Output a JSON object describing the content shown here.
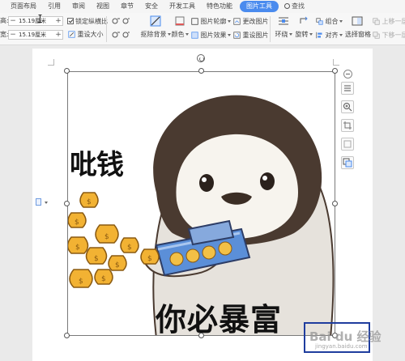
{
  "menu": {
    "tabs": [
      "页面布局",
      "引用",
      "审阅",
      "视图",
      "章节",
      "安全",
      "开发工具",
      "特色功能",
      "图片工具"
    ],
    "active_tab": "图片工具",
    "search_label": "查找"
  },
  "ribbon": {
    "height_label": "高:",
    "width_label": "宽:",
    "height_value": "15.19厘米",
    "width_value": "15.19厘米",
    "lock_ratio_label": "锁定纵横比",
    "lock_ratio_checked": true,
    "reset_size_label": "重设大小",
    "remove_bg_label": "抠除背景",
    "color_label": "颜色",
    "picture_outline_label": "图片轮廓",
    "picture_effect_label": "图片效果",
    "change_picture_label": "更改图片",
    "reset_picture_label": "重设图片",
    "wrap_label": "环绕",
    "rotate_label": "旋转",
    "group_label": "组合",
    "align_label": "对齐",
    "selection_pane_label": "选择窗格",
    "bring_forward_label": "上移一层",
    "send_backward_label": "下移一层"
  },
  "picture": {
    "text_top": "吡钱",
    "text_bottom": "你必暴富"
  },
  "watermark": {
    "brand": "Bai du 经验",
    "sub": "jingyan.baidu.com"
  },
  "colors": {
    "accent": "#4a8bee",
    "watermark_border": "#1f3d9e"
  },
  "icons": [
    "search-icon",
    "rotate-handle-icon",
    "layout-options-icon",
    "zoom-icon",
    "crop-icon",
    "fill-icon",
    "picture-tools-icon",
    "collapse-icon",
    "document-icon"
  ]
}
